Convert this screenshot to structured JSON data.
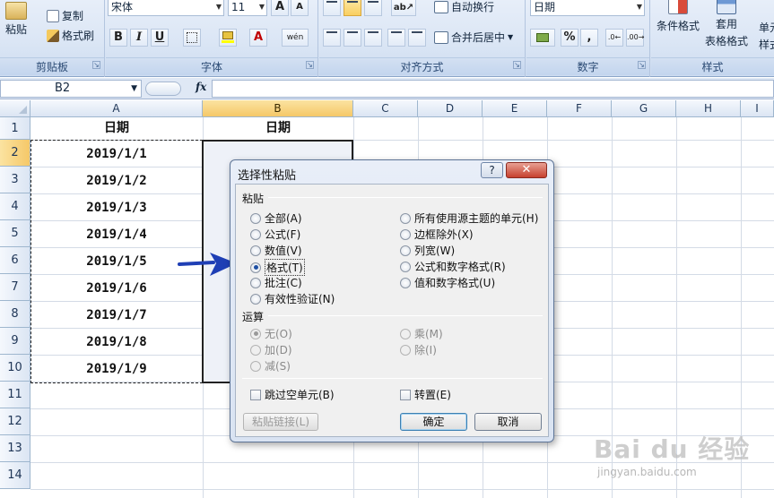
{
  "ribbon": {
    "clipboard": {
      "label": "剪贴板",
      "paste": "粘贴",
      "copy": "复制",
      "format_painter": "格式刷"
    },
    "font": {
      "label": "字体",
      "font_name": "宋体",
      "font_size": "11",
      "bold": "B",
      "italic": "I",
      "underline": "U",
      "grow": "A",
      "shrink": "A",
      "font_color": "A",
      "phonetic": "wén"
    },
    "alignment": {
      "label": "对齐方式",
      "wrap_text": "自动换行",
      "merge_center": "合并后居中"
    },
    "number": {
      "label": "数字",
      "format": "日期",
      "percent": "%",
      "comma": ","
    },
    "styles": {
      "label": "样式",
      "conditional_format": "条件格式",
      "table_format_1": "套用",
      "table_format_2": "表格格式",
      "cell_styles_1": "单元",
      "cell_styles_2": "样式"
    }
  },
  "formula_bar": {
    "name_box": "B2",
    "fx": "fx",
    "formula": ""
  },
  "sheet": {
    "columns": [
      "A",
      "B",
      "C",
      "D",
      "E",
      "F",
      "G",
      "H",
      "I"
    ],
    "rows": [
      "1",
      "2",
      "3",
      "4",
      "5",
      "6",
      "7",
      "8",
      "9",
      "10",
      "11",
      "12",
      "13",
      "14"
    ],
    "a_header": "日期",
    "b_header": "日期",
    "dates": [
      "2019/1/1",
      "2019/1/2",
      "2019/1/3",
      "2019/1/4",
      "2019/1/5",
      "2019/1/6",
      "2019/1/7",
      "2019/1/8",
      "2019/1/9"
    ]
  },
  "dialog": {
    "title": "选择性粘贴",
    "help": "?",
    "close": "✕",
    "paste_section": "粘贴",
    "paste_options_left": [
      "全部(A)",
      "公式(F)",
      "数值(V)",
      "格式(T)",
      "批注(C)",
      "有效性验证(N)"
    ],
    "paste_options_right": [
      "所有使用源主题的单元(H)",
      "边框除外(X)",
      "列宽(W)",
      "公式和数字格式(R)",
      "值和数字格式(U)"
    ],
    "operation_section": "运算",
    "operation_left": [
      "无(O)",
      "加(D)",
      "减(S)"
    ],
    "operation_right": [
      "乘(M)",
      "除(I)"
    ],
    "skip_blanks": "跳过空单元(B)",
    "transpose": "转置(E)",
    "paste_link": "粘贴链接(L)",
    "ok": "确定",
    "cancel": "取消"
  },
  "watermark": {
    "brand": "Bai du 经验",
    "url": "jingyan.baidu.com"
  }
}
